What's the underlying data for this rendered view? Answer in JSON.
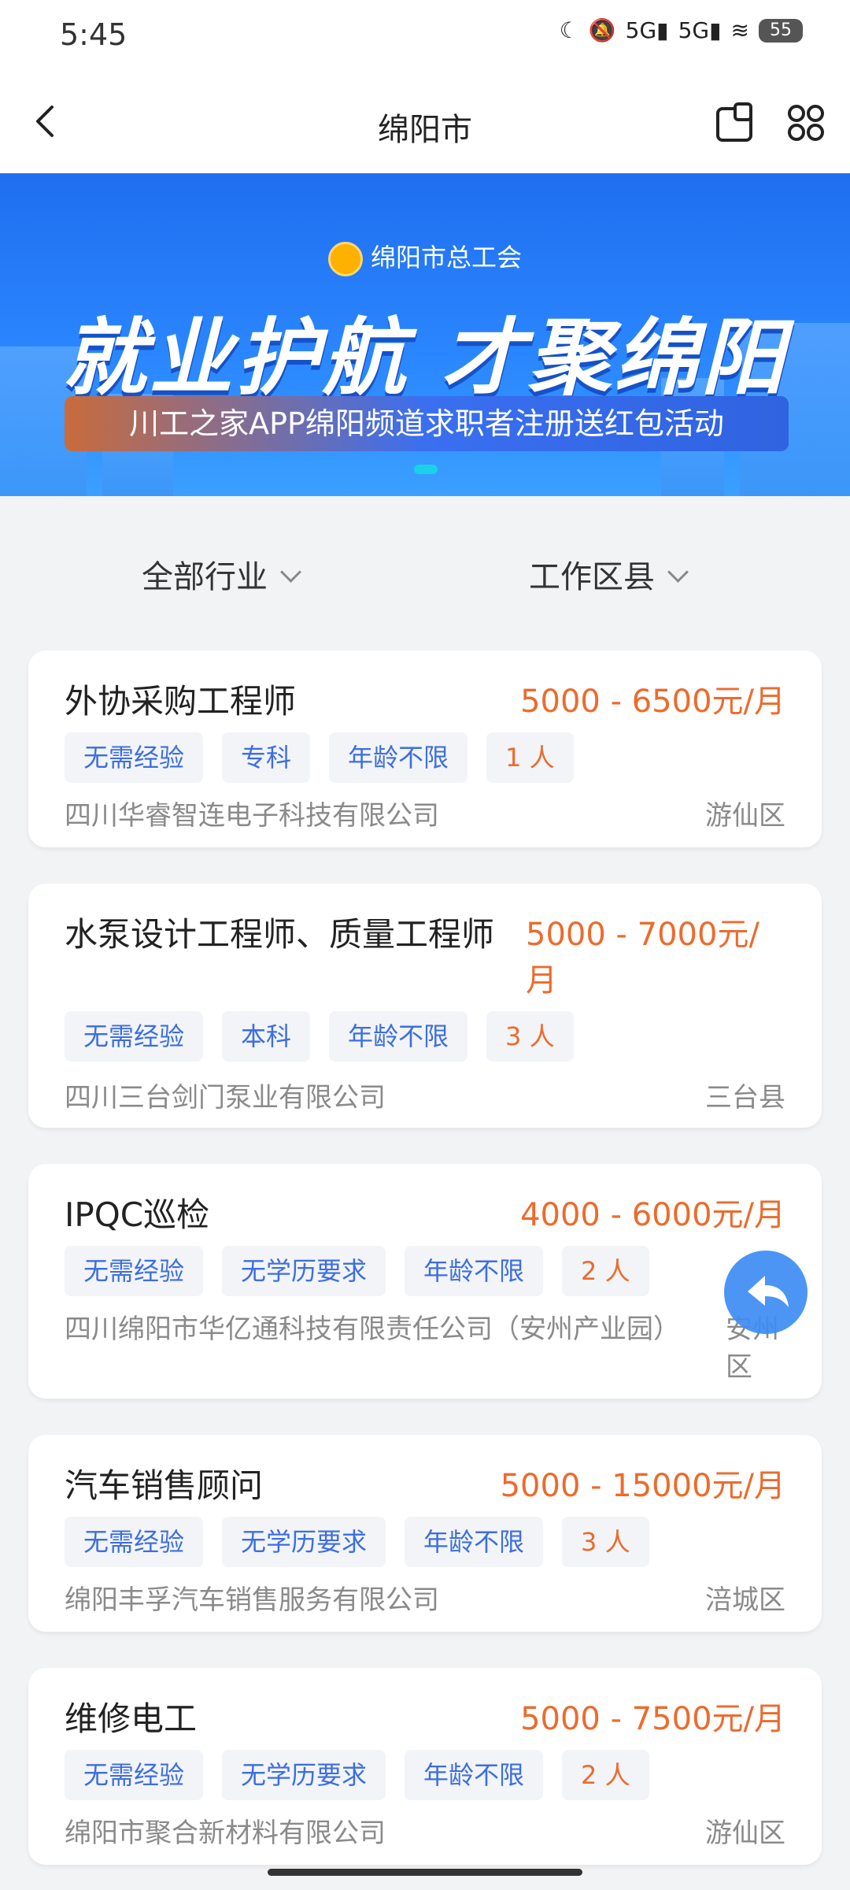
{
  "status_bar": {
    "time": "5:45",
    "network1": "5G",
    "network2": "5G",
    "battery": "55"
  },
  "header": {
    "title": "绵阳市"
  },
  "banner": {
    "org": "绵阳市总工会",
    "slogan": "就业护航 才聚绵阳",
    "subtitle": "川工之家APP绵阳频道求职者注册送红包活动"
  },
  "filters": {
    "industry": "全部行业",
    "district": "工作区县"
  },
  "jobs": [
    {
      "title": "外协采购工程师",
      "salary": "5000 - 6500元/月",
      "tags": [
        "无需经验",
        "专科",
        "年龄不限",
        "1 人"
      ],
      "company": "四川华睿智连电子科技有限公司",
      "district": "游仙区"
    },
    {
      "title": "水泵设计工程师、质量工程师",
      "salary": "5000 - 7000元/月",
      "tags": [
        "无需经验",
        "本科",
        "年龄不限",
        "3 人"
      ],
      "company": "四川三台剑门泵业有限公司",
      "district": "三台县"
    },
    {
      "title": "IPQC巡检",
      "salary": "4000 - 6000元/月",
      "tags": [
        "无需经验",
        "无学历要求",
        "年龄不限",
        "2 人"
      ],
      "company": "四川绵阳市华亿通科技有限责任公司（安州产业园）",
      "district": "安州区"
    },
    {
      "title": "汽车销售顾问",
      "salary": "5000 - 15000元/月",
      "tags": [
        "无需经验",
        "无学历要求",
        "年龄不限",
        "3 人"
      ],
      "company": "绵阳丰孚汽车销售服务有限公司",
      "district": "涪城区"
    },
    {
      "title": "维修电工",
      "salary": "5000 - 7500元/月",
      "tags": [
        "无需经验",
        "无学历要求",
        "年龄不限",
        "2 人"
      ],
      "company": "绵阳市聚合新材料有限公司",
      "district": "游仙区"
    }
  ],
  "icons": {
    "back": "chevron-left-icon",
    "scan": "scan-icon",
    "apps": "apps-icon",
    "share": "share-back-icon"
  },
  "colors": {
    "accent": "#3d6ee0",
    "salary": "#ec6b2d",
    "banner": "#2b88ff"
  }
}
